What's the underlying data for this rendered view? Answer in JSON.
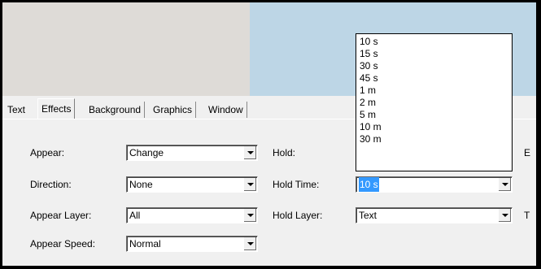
{
  "tabs": [
    {
      "label": "Text"
    },
    {
      "label": "Effects"
    },
    {
      "label": "Background"
    },
    {
      "label": "Graphics"
    },
    {
      "label": "Window"
    }
  ],
  "active_tab": "Effects",
  "form": {
    "appear": {
      "label": "Appear:",
      "value": "Change"
    },
    "direction": {
      "label": "Direction:",
      "value": "None"
    },
    "appear_layer": {
      "label": "Appear Layer:",
      "value": "All"
    },
    "appear_speed": {
      "label": "Appear Speed:",
      "value": "Normal"
    },
    "hold": {
      "label": "Hold:"
    },
    "hold_time": {
      "label": "Hold Time:",
      "value": "10 s"
    },
    "hold_layer": {
      "label": "Hold Layer:",
      "value": "Text"
    },
    "right_col_clipped_1": "E",
    "right_col_clipped_2": "T"
  },
  "hold_time_options": [
    "10 s",
    "15 s",
    "30 s",
    "45 s",
    "1 m",
    "2 m",
    "5 m",
    "10 m",
    "30 m"
  ],
  "colors": {
    "preview_left": "#dedbd7",
    "preview_right": "#bdd6e6",
    "selection": "#3399ff"
  }
}
